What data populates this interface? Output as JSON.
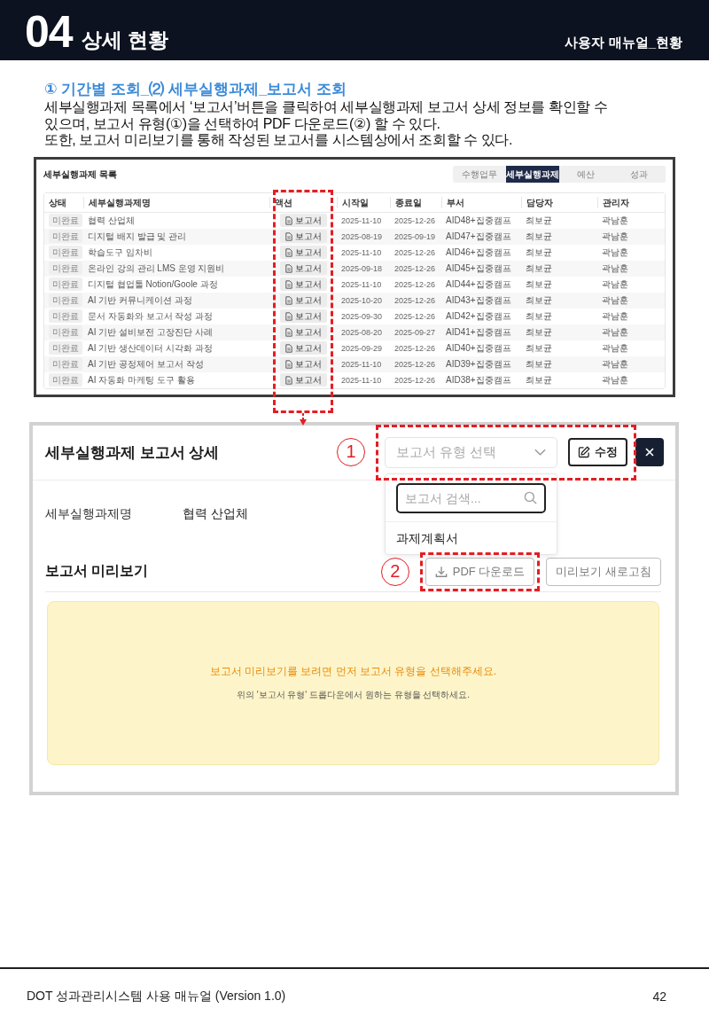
{
  "header": {
    "number": "04",
    "title": "상세 현황",
    "manual_label": "사용자 매뉴얼_현황"
  },
  "intro": {
    "heading": "① 기간별 조회_⑵ 세부실행과제_보고서 조회",
    "lines": [
      "세부실행과제 목록에서 ‘보고서’버튼을 클릭하여 세부실행과제 보고서 상세 정보를 확인할 수",
      "있으며, 보고서 유형(①)을 선택하여 PDF 다운로드(②) 할 수 있다.",
      "또한, 보고서 미리보기를 통해 작성된 보고서를 시스템상에서 조회할 수 있다."
    ]
  },
  "list_screen": {
    "title": "세부실행과제 목록",
    "tabs": [
      {
        "label": "수행업무",
        "selected": false
      },
      {
        "label": "세부실행과제",
        "selected": true
      },
      {
        "label": "예산",
        "selected": false
      },
      {
        "label": "성과",
        "selected": false
      }
    ],
    "table": {
      "columns": [
        {
          "label": "상태",
          "highlighted": false
        },
        {
          "label": "세부실행과제명",
          "highlighted": false
        },
        {
          "label": "액션",
          "highlighted": true
        },
        {
          "label": "시작일",
          "highlighted": false
        },
        {
          "label": "종료일",
          "highlighted": false
        },
        {
          "label": "부서",
          "highlighted": false
        },
        {
          "label": "담당자",
          "highlighted": false
        },
        {
          "label": "관리자",
          "highlighted": false
        }
      ],
      "rows": [
        {
          "status": "미완료",
          "name": "협력 산업체",
          "action": "보고서",
          "start": "2025-11-10",
          "end": "2025-12-26",
          "department": "AID48+집중캠프",
          "owner": "최보균",
          "manager": "곽남훈"
        },
        {
          "status": "미완료",
          "name": "디지털 배지 발급 및 관리",
          "action": "보고서",
          "start": "2025-08-19",
          "end": "2025-09-19",
          "department": "AID47+집중캠프",
          "owner": "최보균",
          "manager": "곽남훈"
        },
        {
          "status": "미완료",
          "name": "학습도구 임차비",
          "action": "보고서",
          "start": "2025-11-10",
          "end": "2025-12-26",
          "department": "AID46+집중캠프",
          "owner": "최보균",
          "manager": "곽남훈"
        },
        {
          "status": "미완료",
          "name": "온라인 강의 관리 LMS 운영 지원비",
          "action": "보고서",
          "start": "2025-09-18",
          "end": "2025-12-26",
          "department": "AID45+집중캠프",
          "owner": "최보균",
          "manager": "곽남훈"
        },
        {
          "status": "미완료",
          "name": "디지털 협업툴 Notion/Goole 과정",
          "action": "보고서",
          "start": "2025-11-10",
          "end": "2025-12-26",
          "department": "AID44+집중캠프",
          "owner": "최보균",
          "manager": "곽남훈"
        },
        {
          "status": "미완료",
          "name": "AI 기반 커뮤니케이션 과정",
          "action": "보고서",
          "start": "2025-10-20",
          "end": "2025-12-26",
          "department": "AID43+집중캠프",
          "owner": "최보균",
          "manager": "곽남훈"
        },
        {
          "status": "미완료",
          "name": "문서 자동화와 보고서 작성 과정",
          "action": "보고서",
          "start": "2025-09-30",
          "end": "2025-12-26",
          "department": "AID42+집중캠프",
          "owner": "최보균",
          "manager": "곽남훈"
        },
        {
          "status": "미완료",
          "name": "AI 기반 설비보전 고장진단 사례",
          "action": "보고서",
          "start": "2025-08-20",
          "end": "2025-09-27",
          "department": "AID41+집중캠프",
          "owner": "최보균",
          "manager": "곽남훈"
        },
        {
          "status": "미완료",
          "name": "AI 기반 생산데이터 시각화 과정",
          "action": "보고서",
          "start": "2025-09-29",
          "end": "2025-12-26",
          "department": "AID40+집중캠프",
          "owner": "최보균",
          "manager": "곽남훈"
        },
        {
          "status": "미완료",
          "name": "AI 기반 공정제어 보고서 작성",
          "action": "보고서",
          "start": "2025-11-10",
          "end": "2025-12-26",
          "department": "AID39+집중캠프",
          "owner": "최보균",
          "manager": "곽남훈"
        },
        {
          "status": "미완료",
          "name": "AI 자동화 마케팅 도구 활용",
          "action": "보고서",
          "start": "2025-11-10",
          "end": "2025-12-26",
          "department": "AID38+집중캠프",
          "owner": "최보균",
          "manager": "곽남훈"
        }
      ]
    }
  },
  "detail_screen": {
    "title": "세부실행과제 보고서 상세",
    "toolbar": {
      "callout": "1",
      "select": {
        "placeholder": "보고서 유형 선택",
        "expanded": true,
        "search_placeholder": "보고서 검색...",
        "options": [
          {
            "label": "과제계획서",
            "selected": false
          }
        ]
      },
      "edit_button": "수정"
    },
    "fields": [
      {
        "label": "세부실행과제명",
        "value": "협력 산업체"
      }
    ],
    "preview": {
      "title": "보고서 미리보기",
      "buttons": [
        {
          "kind": "download",
          "label": "PDF 다운로드",
          "callout": "2"
        },
        {
          "kind": "refresh",
          "label": "미리보기 새로고침"
        }
      ],
      "notice": "보고서 미리보기를 보려면 먼저 보고서 유형을 선택해주세요.",
      "hint": "위의 '보고서 유형' 드롭다운에서 원하는 유형을 선택하세요."
    }
  },
  "footer": {
    "text": "DOT 성과관리시스템 사용 매뉴얼 (Version 1.0)",
    "page": "42"
  }
}
